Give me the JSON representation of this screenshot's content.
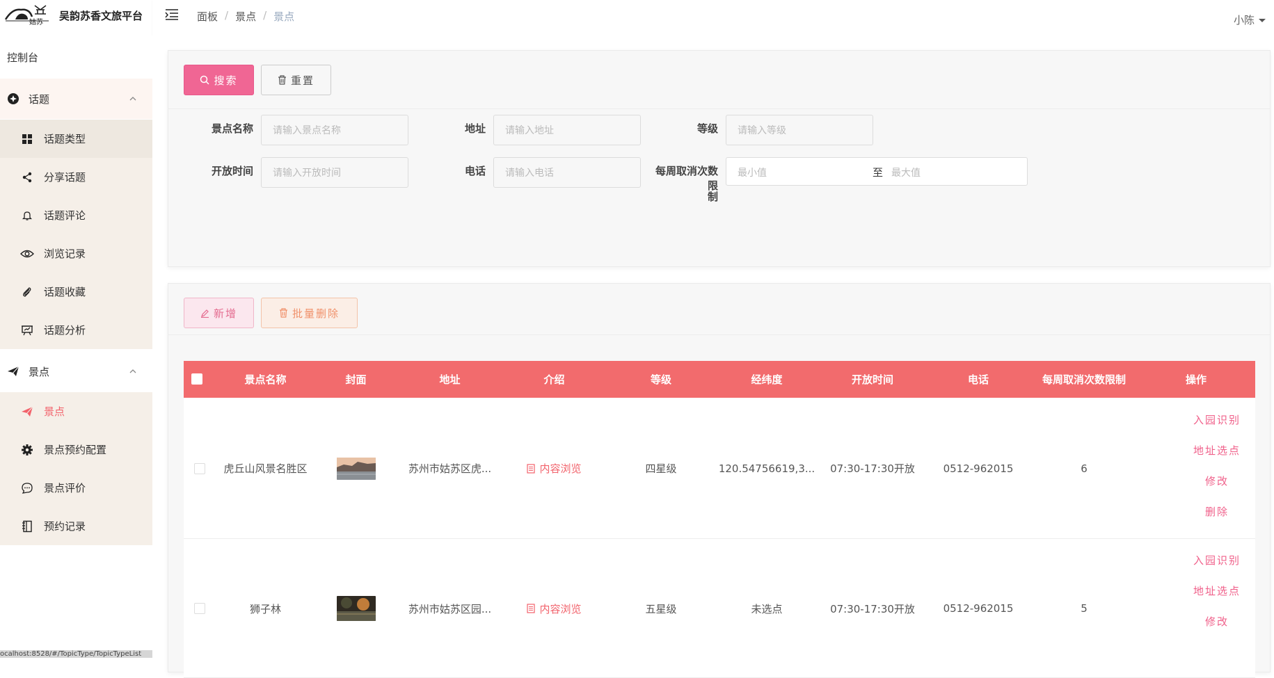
{
  "brand": {
    "title": "吴韵苏香文旅平台",
    "logo_text": "姑苏"
  },
  "sidebar": {
    "console": "控制台",
    "groups": [
      {
        "label": "话题",
        "items": [
          {
            "label": "话题类型",
            "icon": "grid-icon"
          },
          {
            "label": "分享话题",
            "icon": "share-icon"
          },
          {
            "label": "话题评论",
            "icon": "bell-icon"
          },
          {
            "label": "浏览记录",
            "icon": "eye-icon"
          },
          {
            "label": "话题收藏",
            "icon": "paperclip-icon"
          },
          {
            "label": "话题分析",
            "icon": "presentation-icon"
          }
        ]
      },
      {
        "label": "景点",
        "items": [
          {
            "label": "景点",
            "icon": "paper-plane-icon",
            "active": true
          },
          {
            "label": "景点预约配置",
            "icon": "gear-icon"
          },
          {
            "label": "景点评价",
            "icon": "chat-icon"
          },
          {
            "label": "预约记录",
            "icon": "notebook-icon"
          }
        ]
      }
    ]
  },
  "topbar": {
    "breadcrumb": [
      "面板",
      "景点",
      "景点"
    ],
    "user": "小陈"
  },
  "search": {
    "search_btn": "搜索",
    "reset_btn": "重置",
    "fields": {
      "name_label": "景点名称",
      "name_ph": "请输入景点名称",
      "address_label": "地址",
      "address_ph": "请输入地址",
      "level_label": "等级",
      "level_ph": "请输入等级",
      "open_label": "开放时间",
      "open_ph": "请输入开放时间",
      "phone_label": "电话",
      "phone_ph": "请输入电话",
      "limit_label_1": "每周取消次数限",
      "limit_label_2": "制",
      "min_ph": "最小值",
      "range_sep": "至",
      "max_ph": "最大值"
    }
  },
  "actions": {
    "add_btn": "新增",
    "batch_delete_btn": "批量删除"
  },
  "table": {
    "headers": [
      "景点名称",
      "封面",
      "地址",
      "介绍",
      "等级",
      "经纬度",
      "开放时间",
      "电话",
      "每周取消次数限制",
      "操作"
    ],
    "rows": [
      {
        "name": "虎丘山风景名胜区",
        "address": "苏州市姑苏区虎...",
        "intro": "内容浏览",
        "level": "四星级",
        "coords": "120.54756619,3...",
        "open": "07:30-17:30开放",
        "phone": "0512-962015",
        "limit": "6",
        "ops": [
          "入园识别",
          "地址选点",
          "修改",
          "删除"
        ]
      },
      {
        "name": "狮子林",
        "address": "苏州市姑苏区园...",
        "intro": "内容浏览",
        "level": "五星级",
        "coords": "未选点",
        "open": "07:30-17:30开放",
        "phone": "0512-962015",
        "limit": "5",
        "ops": [
          "入园识别",
          "地址选点",
          "修改"
        ]
      }
    ]
  },
  "status_url": "ocalhost:8528/#/TopicType/TopicTypeList"
}
